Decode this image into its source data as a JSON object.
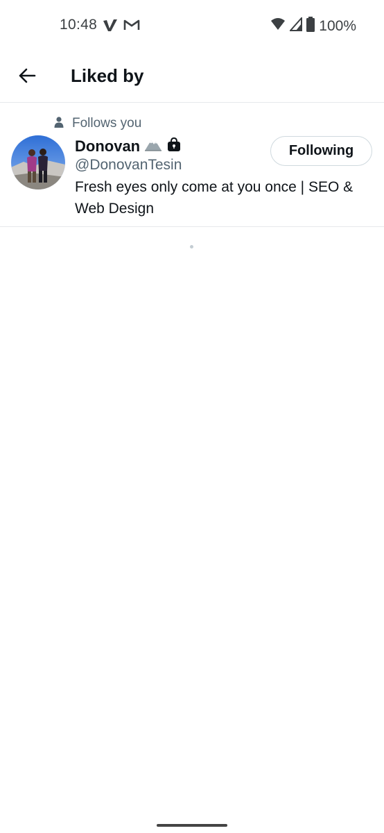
{
  "status_bar": {
    "time": "10:48",
    "battery_text": "100%",
    "icons": [
      "vimeo-icon",
      "gmail-icon",
      "wifi-icon",
      "signal-icon",
      "battery-icon"
    ]
  },
  "header": {
    "title": "Liked by",
    "back_icon": "back-arrow-icon"
  },
  "users": [
    {
      "follows_you_label": "Follows you",
      "display_name": "Donovan",
      "name_emoji": [
        "mountain-icon",
        "shopping-bag-icon"
      ],
      "handle": "@DonovanTesin",
      "bio": "Fresh eyes only come at you once | SEO & Web Design",
      "follow_button_label": "Following"
    }
  ],
  "colors": {
    "primary_text": "#0f1419",
    "secondary_text": "#536471",
    "divider": "#e6e9eb",
    "button_border": "#cfd9de"
  }
}
